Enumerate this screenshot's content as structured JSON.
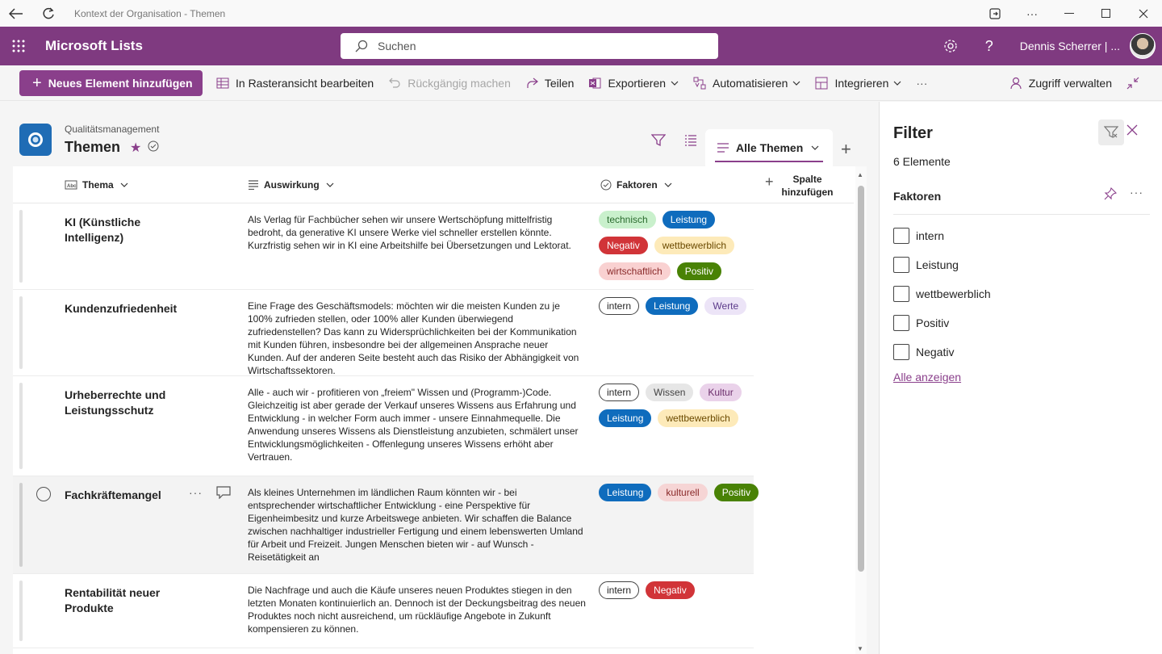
{
  "window": {
    "title": "Kontext der Organisation - Themen"
  },
  "suite": {
    "app_name": "Microsoft Lists",
    "search_placeholder": "Suchen",
    "user_name": "Dennis Scherrer | ..."
  },
  "commands": {
    "new_item": "Neues Element hinzufügen",
    "grid_edit": "In Rasteransicht bearbeiten",
    "undo": "Rückgängig machen",
    "share": "Teilen",
    "export": "Exportieren",
    "automate": "Automatisieren",
    "integrate": "Integrieren",
    "more": "···",
    "manage_access": "Zugriff verwalten"
  },
  "list": {
    "parent": "Qualitätsmanagement",
    "title": "Themen",
    "view_name": "Alle Themen"
  },
  "columns": {
    "thema": "Thema",
    "auswirkung": "Auswirkung",
    "faktoren": "Faktoren",
    "add_line1": "Spalte",
    "add_line2": "hinzufügen"
  },
  "rows": [
    {
      "title": "KI (Künstliche Intelligenz)",
      "desc": "Als Verlag für Fachbücher sehen wir unsere Wertschöpfung mittelfristig bedroht, da generative KI unsere Werke viel schneller erstellen könnte. Kurzfristig sehen wir in KI eine Arbeitshilfe bei Übersetzungen und Lektorat.",
      "tags": [
        "technisch",
        "Leistung",
        "Negativ",
        "wettbewerblich",
        "wirtschaftlich",
        "Positiv"
      ]
    },
    {
      "title": "Kundenzufriedenheit",
      "desc": "Eine Frage des Geschäftsmodels: möchten wir die meisten Kunden zu je 100% zufrieden stellen, oder 100% aller Kunden überwiegend zufriedenstellen? Das kann zu Widersprüchlichkeiten bei der Kommunikation mit Kunden führen, insbesondre bei der allgemeinen Ansprache neuer Kunden. Auf der anderen Seite besteht auch das Risiko der Abhängigkeit von Wirtschaftssektoren.",
      "tags": [
        "intern",
        "Leistung",
        "Werte"
      ]
    },
    {
      "title": "Urheberrechte und Leistungsschutz",
      "desc": "Alle - auch wir - profitieren von „freiem\" Wissen und (Programm-)Code. Gleichzeitig ist aber gerade der Verkauf unseres Wissens aus Erfahrung und Entwicklung - in welcher Form auch immer - unsere Einnahmequelle. Die Anwendung unseres Wissens als Dienstleistung anzubieten, schmälert unser Entwicklungsmöglichkeiten - Offenlegung unseres Wissens erhöht aber Vertrauen.",
      "tags": [
        "intern",
        "Wissen",
        "Kultur",
        "Leistung",
        "wettbewerblich"
      ]
    },
    {
      "title": "Fachkräftemangel",
      "desc": "Als kleines Unternehmen im ländlichen Raum könnten wir - bei entsprechender wirtschaftlicher Entwicklung - eine Perspektive für Eigenheimbesitz und kurze Arbeitswege anbieten. Wir schaffen die Balance zwischen nachhaltiger industrieller Fertigung und einem lebenswerten Umland für Arbeit und Freizeit. Jungen Menschen bieten wir - auf Wunsch - Reisetätigkeit an",
      "tags": [
        "Leistung",
        "kulturell",
        "Positiv"
      ]
    },
    {
      "title": "Rentabilität neuer Produkte",
      "desc": "Die Nachfrage und auch die Käufe unseres neuen Produktes stiegen in den letzten Monaten kontinuierlich an. Dennoch ist der Deckungsbeitrag des neuen Produktes noch nicht ausreichend, um rückläufige Angebote in Zukunft kompensieren zu können.",
      "tags": [
        "intern",
        "Negativ"
      ]
    }
  ],
  "tag_colors": {
    "technisch": {
      "bg": "#c9f0cc",
      "fg": "#2a6b2e",
      "border": "#c9f0cc"
    },
    "Leistung": {
      "bg": "#0f6cbd",
      "fg": "#ffffff",
      "border": "#0f6cbd"
    },
    "Negativ": {
      "bg": "#d13438",
      "fg": "#ffffff",
      "border": "#d13438"
    },
    "wettbewerblich": {
      "bg": "#fdeab9",
      "fg": "#6b4a00",
      "border": "#fdeab9"
    },
    "wirtschaftlich": {
      "bg": "#f9d1d1",
      "fg": "#8a2a2a",
      "border": "#f9d1d1"
    },
    "Positiv": {
      "bg": "#498205",
      "fg": "#ffffff",
      "border": "#498205"
    },
    "intern": {
      "bg": "#ffffff",
      "fg": "#242424",
      "border": "#424242"
    },
    "Werte": {
      "bg": "#ece4f7",
      "fg": "#5b3a8a",
      "border": "#ece4f7"
    },
    "Wissen": {
      "bg": "#e6e6e6",
      "fg": "#424242",
      "border": "#e6e6e6"
    },
    "Kultur": {
      "bg": "#ead2ea",
      "fg": "#6b2d6b",
      "border": "#ead2ea"
    },
    "kulturell": {
      "bg": "#f6d5d5",
      "fg": "#8a2a2a",
      "border": "#f6d5d5"
    }
  },
  "filter": {
    "title": "Filter",
    "count": "6 Elemente",
    "section": "Faktoren",
    "options": [
      "intern",
      "Leistung",
      "wettbewerblich",
      "Positiv",
      "Negativ"
    ],
    "show_all": "Alle anzeigen"
  },
  "accent": "#7f3a80"
}
